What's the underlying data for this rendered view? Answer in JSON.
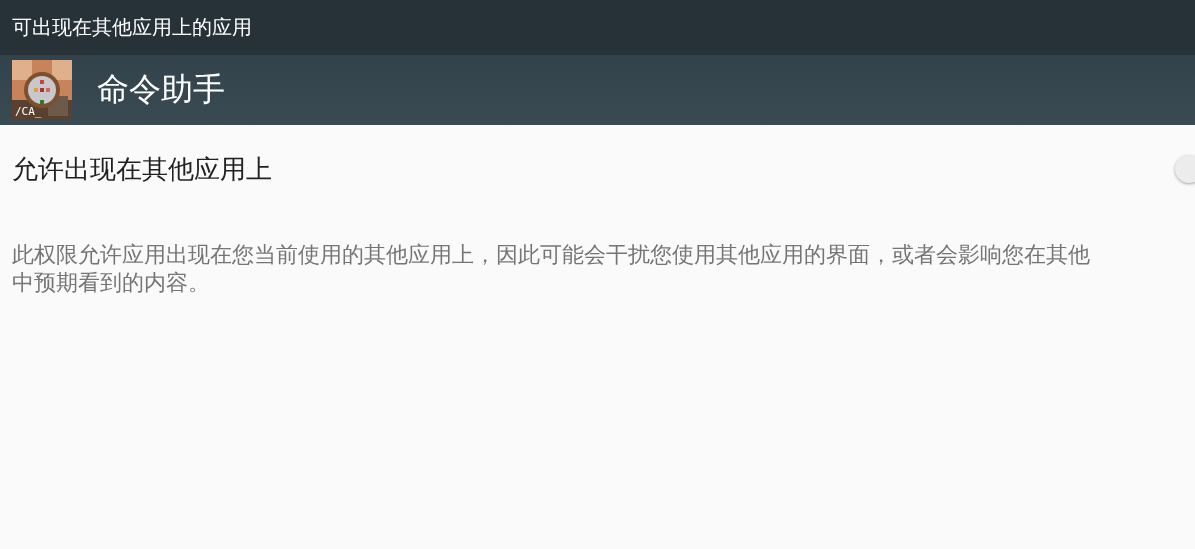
{
  "status_bar": {
    "title": "可出现在其他应用上的应用"
  },
  "app_bar": {
    "icon_text": "/CA_",
    "app_name": "命令助手"
  },
  "setting": {
    "title": "允许出现在其他应用上",
    "on": false
  },
  "description": {
    "lines": [
      "此权限允许应用出现在您当前使用的其他应用上，因此可能会干扰您使用其他应用的界面，或者会影响您在其他",
      "中预期看到的内容。"
    ]
  }
}
